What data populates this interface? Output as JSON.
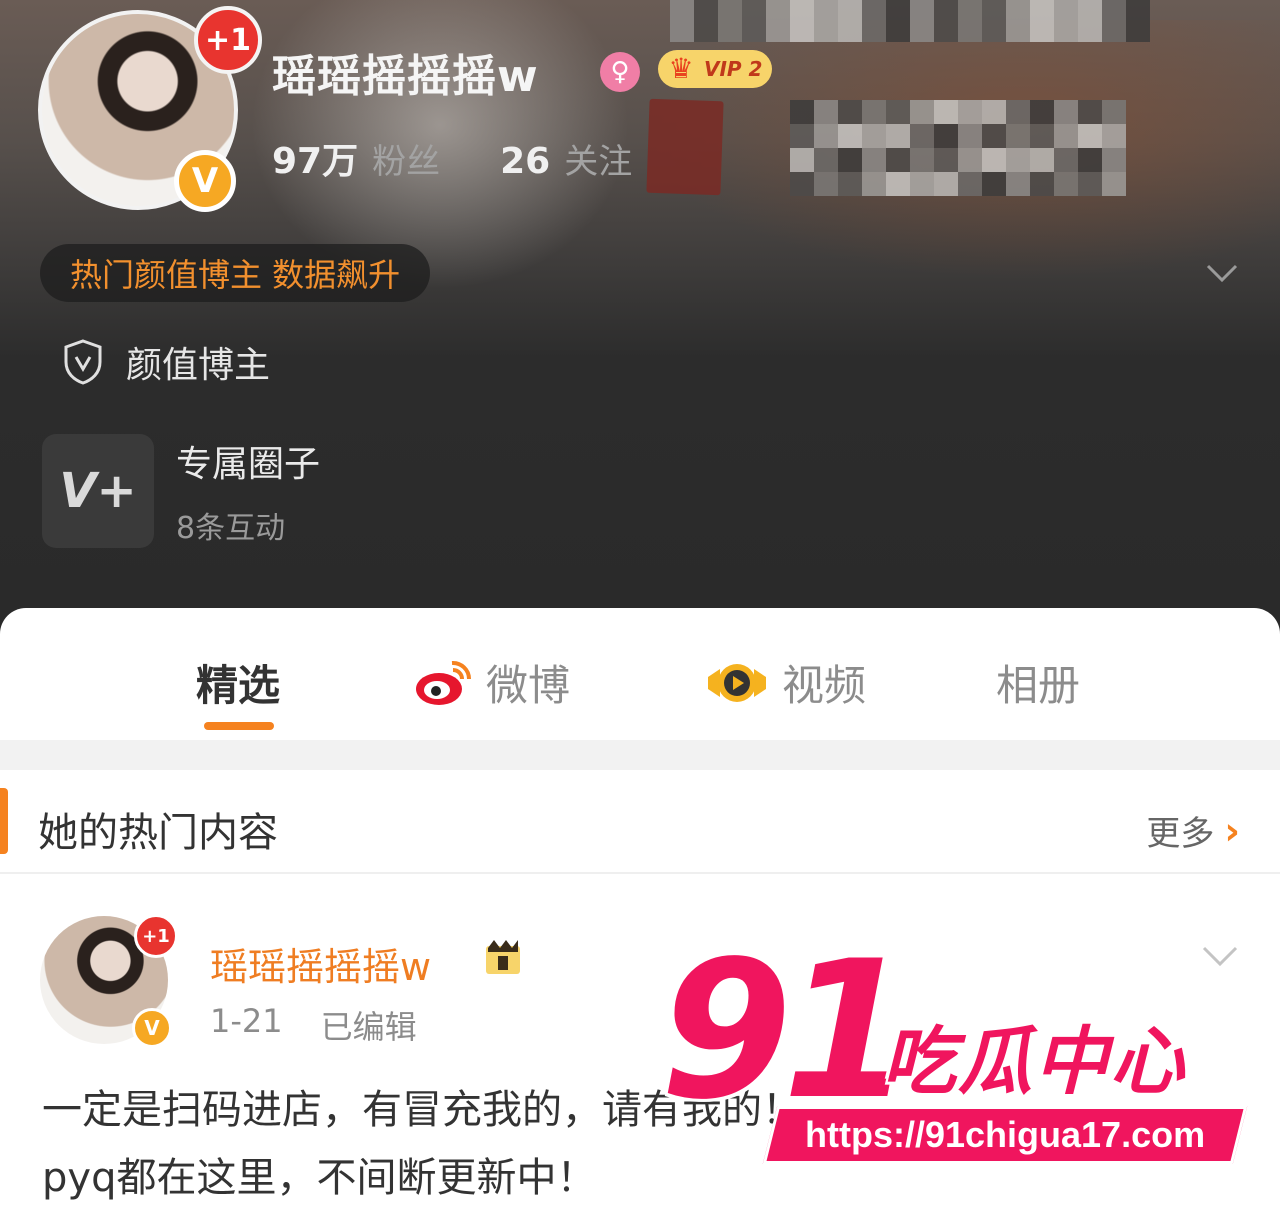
{
  "profile": {
    "username": "瑶瑶摇摇摇w",
    "plus_badge": "+1",
    "verified_badge": "V",
    "gender_icon": "female-icon",
    "vip_label": "VIP 2",
    "fans_count": "97万",
    "fans_label": "粉丝",
    "following_count": "26",
    "following_label": "关注",
    "hot_pill": "热门颜值博主 数据飙升",
    "certification": "颜值博主",
    "circle_title": "专属圈子",
    "circle_sub": "8条互动",
    "circle_tile_text": "V+"
  },
  "tabs": [
    {
      "label": "精选",
      "active": true
    },
    {
      "label": "微博",
      "icon": "weibo-icon"
    },
    {
      "label": "视频",
      "icon": "video-icon"
    },
    {
      "label": "相册"
    }
  ],
  "hot_section": {
    "title": "她的热门内容",
    "more_label": "更多",
    "more_icon": "chevron-right-icon"
  },
  "post": {
    "author": "瑶瑶摇摇摇w",
    "plus_badge": "+1",
    "verified_badge": "V",
    "date": "1-21",
    "edited": "已编辑",
    "text_line1": "一定是扫码进店，有冒充我的，请有我的！",
    "text_line2": "pyq都在这里，不间断更新中！"
  },
  "watermark": {
    "number": "91",
    "text": "吃瓜中心",
    "url": "https://91chigua17.com"
  },
  "colors": {
    "accent_orange": "#f5821f",
    "watermark_pink": "#f0155e",
    "vip_gold": "#f7d46a"
  }
}
